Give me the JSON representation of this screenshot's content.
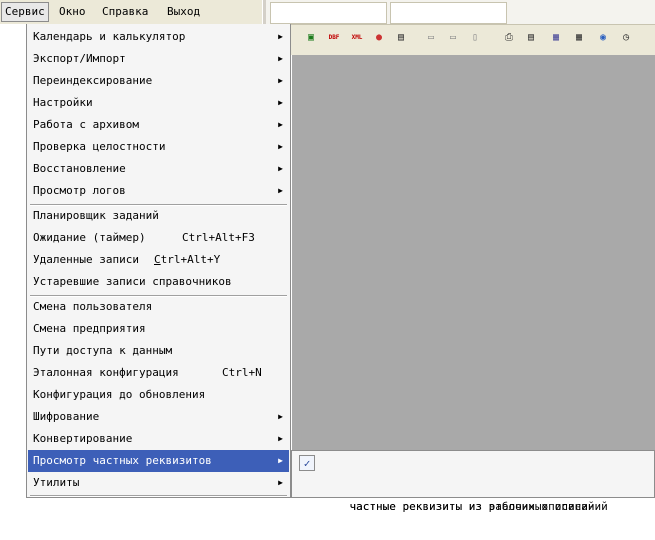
{
  "menubar": {
    "items": [
      {
        "label": "Сервис"
      },
      {
        "label": "Окно"
      },
      {
        "label": "Справка"
      },
      {
        "label": "Выход"
      }
    ]
  },
  "toolbar": {
    "buttons": [
      {
        "name": "excel-icon",
        "glyph": "▣",
        "color": "#1a7a1a"
      },
      {
        "name": "dbf-export-icon",
        "glyph": "DBF",
        "color": "#c00000"
      },
      {
        "name": "xml-export-icon",
        "glyph": "XML",
        "color": "#c00000"
      },
      {
        "name": "web-icon",
        "glyph": "●",
        "color": "#cc3333"
      },
      {
        "name": "save-icon",
        "glyph": "▤",
        "color": "#333333"
      },
      {
        "name": "cascade-icon",
        "glyph": "▭",
        "color": "#8a8a8a"
      },
      {
        "name": "tile-horizontal-icon",
        "glyph": "▭",
        "color": "#8a8a8a"
      },
      {
        "name": "tile-vertical-icon",
        "glyph": "▯",
        "color": "#8a8a8a"
      },
      {
        "name": "print-icon",
        "glyph": "⎙",
        "color": "#333333"
      },
      {
        "name": "document-icon",
        "glyph": "▤",
        "color": "#333333"
      },
      {
        "name": "calendar-icon",
        "glyph": "▦",
        "color": "#4a4a9a"
      },
      {
        "name": "calculator-icon",
        "glyph": "▦",
        "color": "#333333"
      },
      {
        "name": "search-web-icon",
        "glyph": "◉",
        "color": "#2a5fc0"
      },
      {
        "name": "timer-icon",
        "glyph": "◷",
        "color": "#333333"
      }
    ]
  },
  "menu": {
    "items": [
      {
        "label": "Календарь и калькулятор",
        "submenu": true
      },
      {
        "label": "Экспорт/Импорт",
        "submenu": true
      },
      {
        "label": "Переиндексирование",
        "submenu": true
      },
      {
        "label": "Настройки",
        "submenu": true
      },
      {
        "label": "Работа с архивом",
        "submenu": true
      },
      {
        "label": "Проверка целостности",
        "submenu": true
      },
      {
        "label": "Восстановление",
        "submenu": true
      },
      {
        "label": "Просмотр логов",
        "submenu": true
      },
      {
        "label": "Планировщик заданий"
      },
      {
        "label": "Ожидание (таймер)",
        "shortcut": "Ctrl+Alt+F3"
      },
      {
        "label": "Удаленные записи",
        "shortcut_pre": "",
        "shortcut_u": "C",
        "shortcut_post": "trl+Alt+Y"
      },
      {
        "label": "Устаревшие записи справочников"
      },
      {
        "label": "Смена пользователя"
      },
      {
        "label": "Смена предприятия"
      },
      {
        "label": "Пути доступа к данным"
      },
      {
        "label": "Эталонная конфигурация",
        "shortcut": "Ctrl+N"
      },
      {
        "label": "Конфигурация до обновления"
      },
      {
        "label": "Шифрование",
        "submenu": true
      },
      {
        "label": "Конвертирование",
        "submenu": true
      },
      {
        "label": "Просмотр частных реквизитов",
        "submenu": true
      },
      {
        "label": "Утилиты",
        "submenu": true
      }
    ],
    "arrow": "▶"
  },
  "submenu": {
    "items": [
      {
        "label": "частные реквизиты из рабочих описаний",
        "checked": true
      },
      {
        "label": "частные реквизиты из эталонных описаний"
      }
    ],
    "check_glyph": "✓"
  }
}
